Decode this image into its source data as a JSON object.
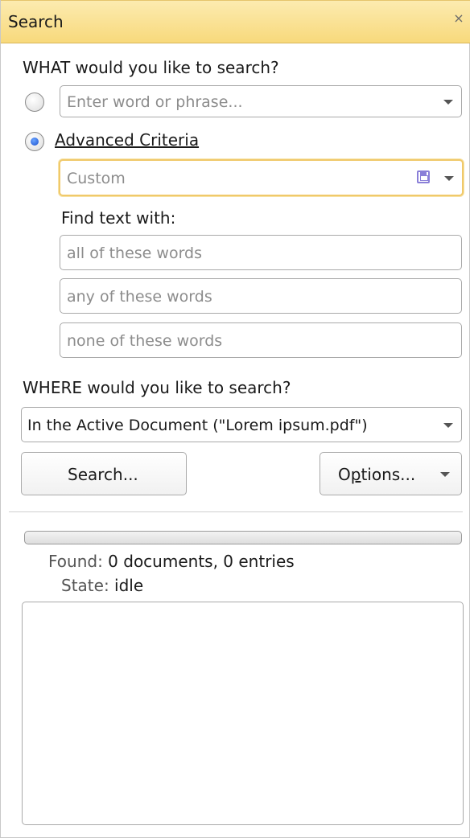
{
  "panel": {
    "title": "Search",
    "close_glyph": "×"
  },
  "what": {
    "heading": "WHAT would you like to search?",
    "phrase_placeholder": "Enter word or phrase...",
    "advanced_label": "Advanced Criteria",
    "advanced_selected": true,
    "criteria_preset": "Custom",
    "find_text_label": "Find text with:",
    "all_words_placeholder": "all of these words",
    "any_words_placeholder": "any of these words",
    "none_words_placeholder": "none of these words"
  },
  "where": {
    "heading": "WHERE would you like to search?",
    "scope_value": "In the Active Document (\"Lorem ipsum.pdf\")"
  },
  "buttons": {
    "search_label": "Search...",
    "options_label_pre": "O",
    "options_label_mnemonic": "p",
    "options_label_post": "tions..."
  },
  "status": {
    "progress_fraction": 0,
    "found_label": "Found:",
    "found_value": "0 documents, 0 entries",
    "state_label": "State:",
    "state_value": "idle"
  },
  "icons": {
    "save": "save-icon",
    "dropdown": "chevron-down-icon",
    "close": "close-icon"
  },
  "colors": {
    "title_bar": "#f8d97c",
    "radio_selected": "#1a4fcf",
    "highlight_border": "#f0c96a"
  }
}
